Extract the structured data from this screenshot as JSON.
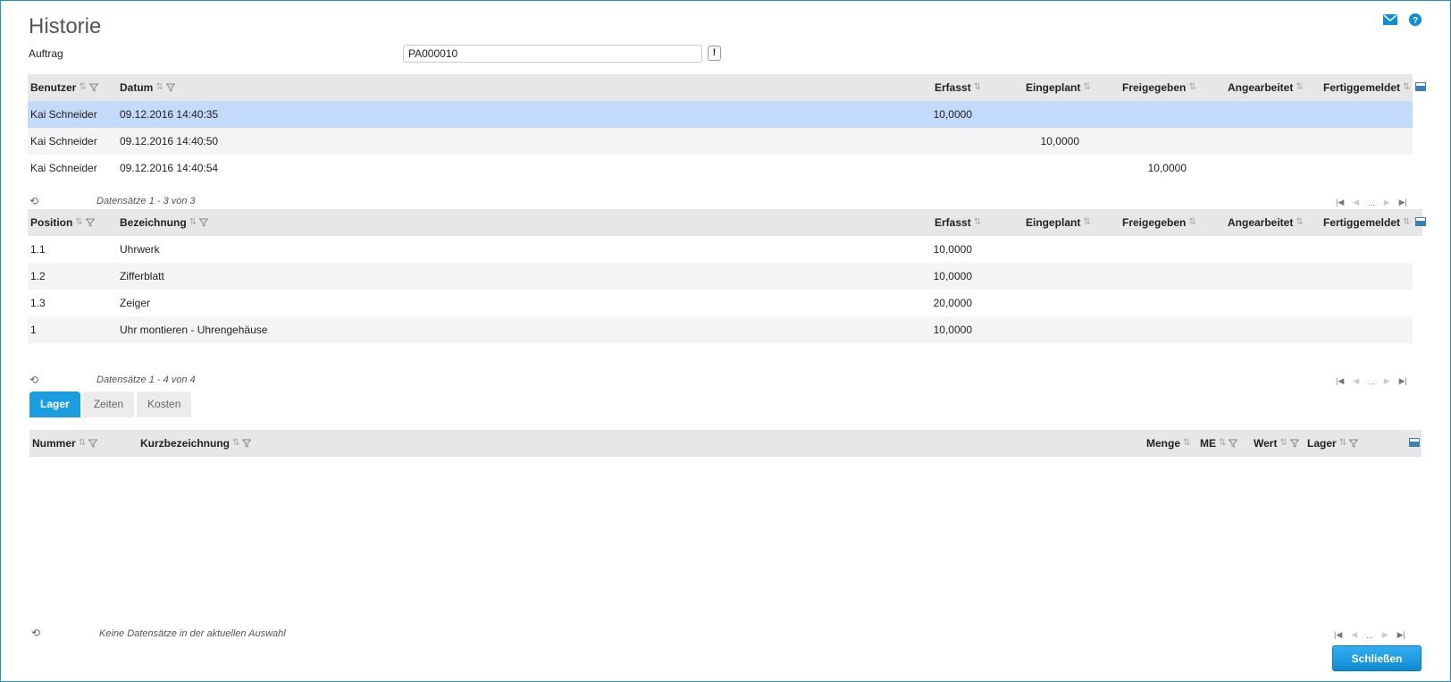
{
  "title": "Historie",
  "order": {
    "label": "Auftrag",
    "value": "PA000010",
    "action_label": "!"
  },
  "history": {
    "headers": [
      "Benutzer",
      "Datum",
      "Erfasst",
      "Eingeplant",
      "Freigegeben",
      "Angearbeitet",
      "Fertiggemeldet"
    ],
    "rows": [
      {
        "user": "Kai Schneider",
        "date": "09.12.2016 14:40:35",
        "erfasst": "10,0000",
        "eingeplant": "",
        "freigegeben": ""
      },
      {
        "user": "Kai Schneider",
        "date": "09.12.2016 14:40:50",
        "erfasst": "",
        "eingeplant": "10,0000",
        "freigegeben": ""
      },
      {
        "user": "Kai Schneider",
        "date": "09.12.2016 14:40:54",
        "erfasst": "",
        "eingeplant": "",
        "freigegeben": "10,0000"
      }
    ],
    "pager": "Datensätze 1 - 3 von 3"
  },
  "positions": {
    "headers": [
      "Position",
      "Bezeichnung",
      "Erfasst",
      "Eingeplant",
      "Freigegeben",
      "Angearbeitet",
      "Fertiggemeldet"
    ],
    "rows": [
      {
        "pos": "1.1",
        "name": "Uhrwerk",
        "erfasst": "10,0000"
      },
      {
        "pos": "1.2",
        "name": "Zifferblatt",
        "erfasst": "10,0000"
      },
      {
        "pos": "1.3",
        "name": "Zeiger",
        "erfasst": "20,0000"
      },
      {
        "pos": "1",
        "name": "Uhr montieren - Uhrengehäuse",
        "erfasst": "10,0000"
      }
    ],
    "pager": "Datensätze 1 - 4 von 4"
  },
  "tabs": [
    "Lager",
    "Zeiten",
    "Kosten"
  ],
  "stock": {
    "headers": [
      "Nummer",
      "Kurzbezeichnung",
      "Menge",
      "ME",
      "Wert",
      "Lager"
    ],
    "pager": "Keine Datensätze in der aktuellen Auswahl"
  },
  "pager_ellipsis": "...",
  "close_label": "Schließen",
  "colors": {
    "accent": "#1a9ee0",
    "selected_row": "#c3dafa",
    "header_bg": "#e7e7e7"
  }
}
